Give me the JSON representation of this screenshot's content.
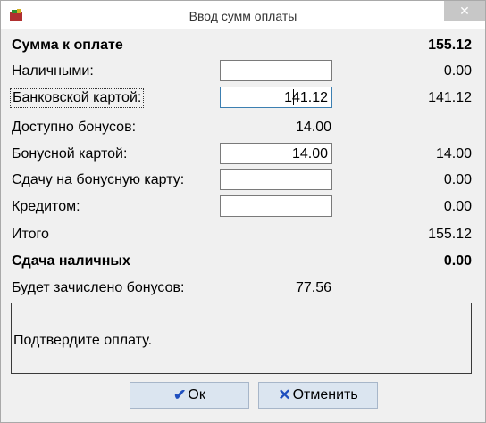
{
  "window": {
    "title": "Ввод сумм оплаты",
    "close": "✕"
  },
  "rows": {
    "to_pay": {
      "label": "Сумма к оплате",
      "value": "155.12"
    },
    "cash": {
      "label": "Наличными:",
      "input": "",
      "value": "0.00"
    },
    "card": {
      "label": "Банковской картой:",
      "input": "141.12",
      "value": "141.12"
    },
    "bonus_available": {
      "label": "Доступно бонусов:",
      "value": "14.00"
    },
    "bonus_card": {
      "label": "Бонусной картой:",
      "input": "14.00",
      "value": "14.00"
    },
    "change_to_bonus": {
      "label": "Сдачу на бонусную карту:",
      "input": "",
      "value": "0.00"
    },
    "credit": {
      "label": "Кредитом:",
      "input": "",
      "value": "0.00"
    },
    "total": {
      "label": "Итого",
      "value": "155.12"
    },
    "change_cash": {
      "label": "Сдача наличных",
      "value": "0.00"
    },
    "bonus_accrued": {
      "label": "Будет зачислено бонусов:",
      "value": "77.56"
    }
  },
  "message": "Подтвердите оплату.",
  "buttons": {
    "ok": "Ок",
    "cancel": "Отменить"
  },
  "icons": {
    "ok": "check-icon",
    "cancel": "cross-icon"
  },
  "colors": {
    "ok_icon": "#1f4fbf",
    "cancel_icon": "#1f4fbf",
    "button_bg": "#dbe5f0"
  }
}
